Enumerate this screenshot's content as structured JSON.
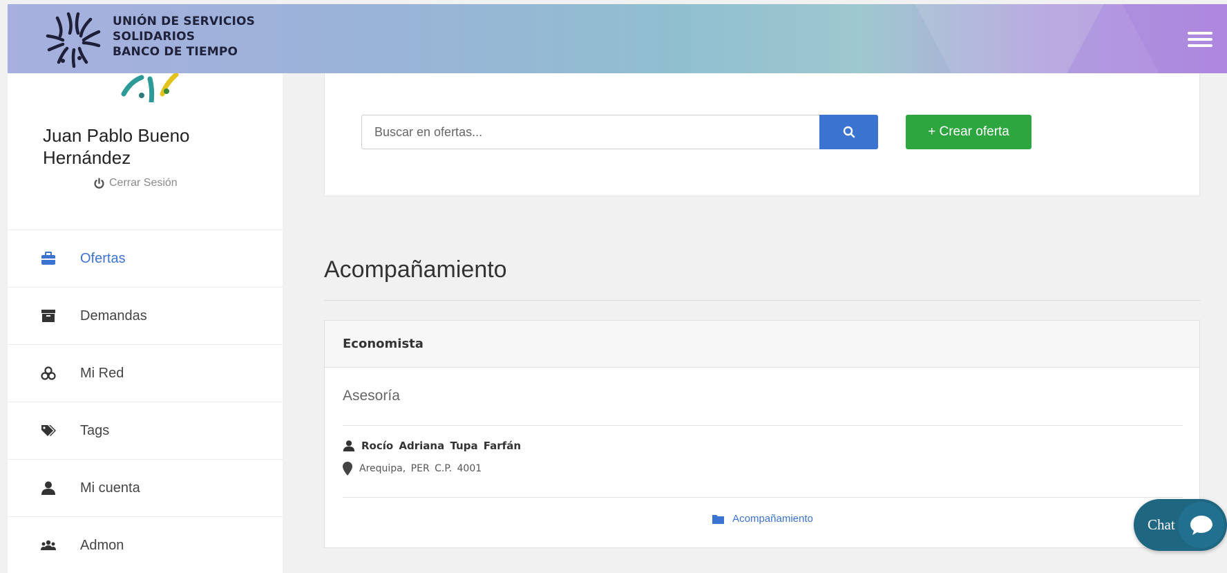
{
  "header": {
    "logo_lines": [
      "UNIÓN DE SERVICIOS",
      "SOLIDARIOS",
      "BANCO DE TIEMPO"
    ],
    "menu_icon": "hamburger-icon"
  },
  "sidebar": {
    "user_name": "Juan Pablo Bueno Hernández",
    "logout_label": "Cerrar Sesión",
    "items": [
      {
        "label": "Ofertas",
        "icon": "briefcase-icon",
        "active": true
      },
      {
        "label": "Demandas",
        "icon": "archive-icon",
        "active": false
      },
      {
        "label": "Mi Red",
        "icon": "network-icon",
        "active": false
      },
      {
        "label": "Tags",
        "icon": "tags-icon",
        "active": false
      },
      {
        "label": "Mi cuenta",
        "icon": "user-icon",
        "active": false
      },
      {
        "label": "Admon",
        "icon": "users-icon",
        "active": false
      }
    ]
  },
  "search": {
    "placeholder": "Buscar en ofertas...",
    "create_label": "+ Crear oferta"
  },
  "section": {
    "title": "Acompañamiento"
  },
  "offer": {
    "title": "Economista",
    "subtitle": "Asesoría",
    "person": "Rocío Adriana Tupa Farfán",
    "location": "Arequipa, PER C.P. 4001",
    "category": "Acompañamiento"
  },
  "chat": {
    "label": "Chat"
  },
  "colors": {
    "accent_blue": "#3b73d1",
    "create_green": "#2ea63f",
    "chat_teal": "#1f6680"
  }
}
